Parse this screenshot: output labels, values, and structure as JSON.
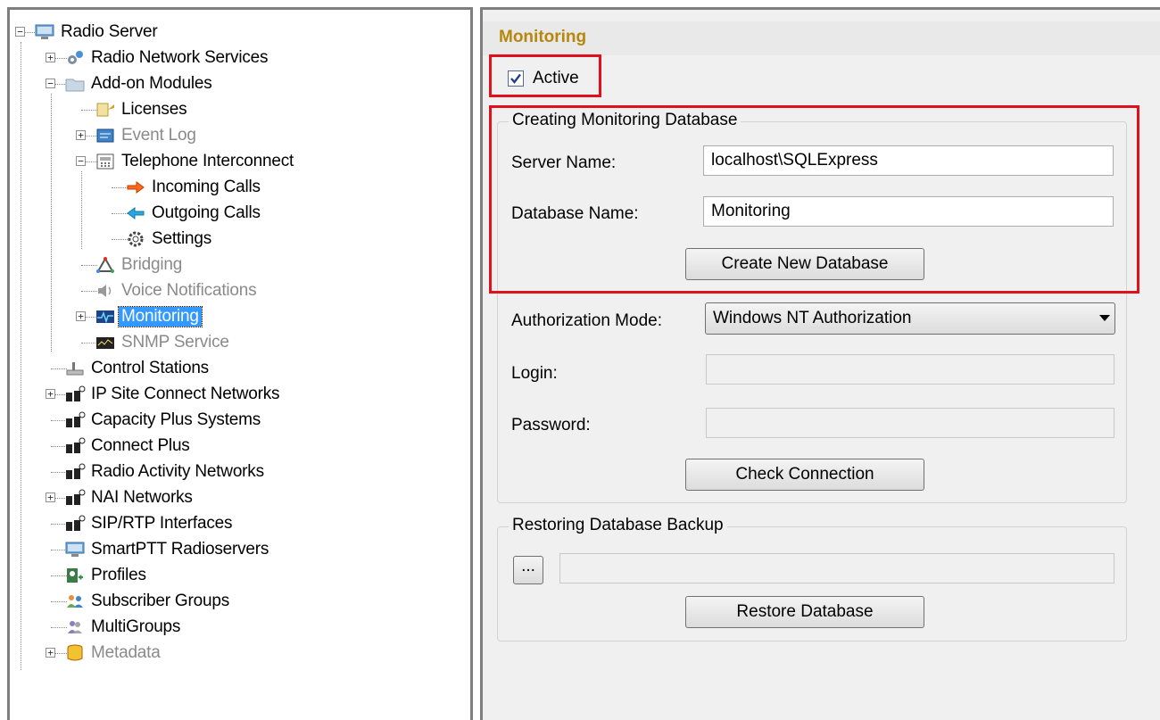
{
  "tree": {
    "items": [
      {
        "label": "Radio Server",
        "icon": "server-icon",
        "expander": "−",
        "disabled": false
      },
      {
        "label": "Radio Network Services",
        "icon": "network-services-icon",
        "expander": "+",
        "disabled": false
      },
      {
        "label": "Add-on Modules",
        "icon": "modules-icon",
        "expander": "−",
        "disabled": false
      },
      {
        "label": "Licenses",
        "icon": "licenses-icon",
        "expander": "",
        "disabled": false
      },
      {
        "label": "Event Log",
        "icon": "event-log-icon",
        "expander": "+",
        "disabled": true
      },
      {
        "label": "Telephone Interconnect",
        "icon": "telephone-icon",
        "expander": "−",
        "disabled": false
      },
      {
        "label": "Incoming Calls",
        "icon": "incoming-arrow-icon",
        "expander": "",
        "disabled": false
      },
      {
        "label": "Outgoing Calls",
        "icon": "outgoing-arrow-icon",
        "expander": "",
        "disabled": false
      },
      {
        "label": "Settings",
        "icon": "gear-icon",
        "expander": "",
        "disabled": false
      },
      {
        "label": "Bridging",
        "icon": "bridging-icon",
        "expander": "",
        "disabled": true
      },
      {
        "label": "Voice Notifications",
        "icon": "speaker-icon",
        "expander": "",
        "disabled": true
      },
      {
        "label": "Monitoring",
        "icon": "monitoring-icon",
        "expander": "+",
        "disabled": false,
        "selected": true
      },
      {
        "label": "SNMP Service",
        "icon": "snmp-icon",
        "expander": "",
        "disabled": true
      },
      {
        "label": "Control Stations",
        "icon": "control-station-icon",
        "expander": "",
        "disabled": false
      },
      {
        "label": "IP Site Connect Networks",
        "icon": "radio-network-icon",
        "expander": "+",
        "disabled": false
      },
      {
        "label": "Capacity Plus Systems",
        "icon": "radio-network-icon",
        "expander": "",
        "disabled": false
      },
      {
        "label": "Connect Plus",
        "icon": "radio-network-icon",
        "expander": "",
        "disabled": false
      },
      {
        "label": "Radio Activity Networks",
        "icon": "radio-network-icon",
        "expander": "",
        "disabled": false
      },
      {
        "label": "NAI Networks",
        "icon": "radio-network-icon",
        "expander": "+",
        "disabled": false
      },
      {
        "label": "SIP/RTP Interfaces",
        "icon": "radio-network-icon",
        "expander": "",
        "disabled": false
      },
      {
        "label": "SmartPTT Radioservers",
        "icon": "server-icon",
        "expander": "",
        "disabled": false
      },
      {
        "label": "Profiles",
        "icon": "profiles-icon",
        "expander": "",
        "disabled": false
      },
      {
        "label": "Subscriber Groups",
        "icon": "subscriber-groups-icon",
        "expander": "",
        "disabled": false
      },
      {
        "label": "MultiGroups",
        "icon": "multigroups-icon",
        "expander": "",
        "disabled": false
      },
      {
        "label": "Metadata",
        "icon": "metadata-icon",
        "expander": "+",
        "disabled": true
      }
    ]
  },
  "settings": {
    "title": "Monitoring",
    "active_label": "Active",
    "active_checked": true,
    "creating_group": {
      "legend": "Creating Monitoring Database",
      "server_name_label": "Server Name:",
      "server_name_value": "localhost\\SQLExpress",
      "database_name_label": "Database Name:",
      "database_name_value": "Monitoring",
      "create_button": "Create New Database",
      "authorization_mode_label": "Authorization Mode:",
      "authorization_mode_value": "Windows NT Authorization",
      "login_label": "Login:",
      "login_value": "",
      "password_label": "Password:",
      "password_value": "",
      "check_button": "Check Connection"
    },
    "restore_group": {
      "legend": "Restoring Database Backup",
      "browse_button": "...",
      "path_value": "",
      "restore_button": "Restore Database"
    }
  },
  "colors": {
    "title_gold": "#b8860b",
    "highlight_red": "#e0101c",
    "selection_blue": "#3399ff"
  }
}
